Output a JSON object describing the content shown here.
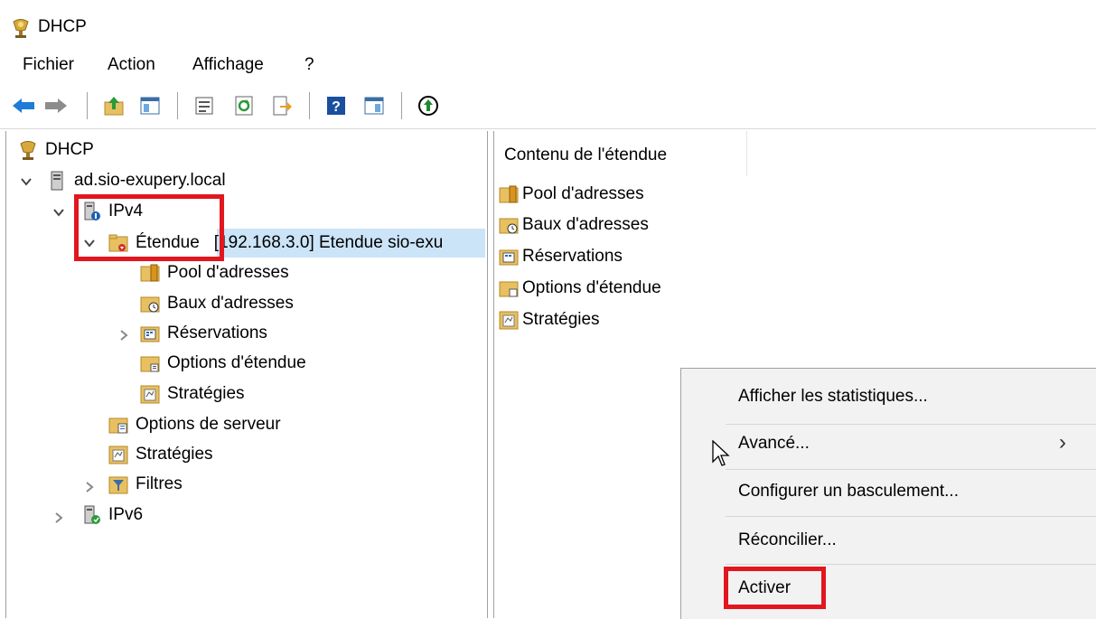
{
  "window": {
    "title": "DHCP"
  },
  "menu": [
    {
      "label": "Fichier"
    },
    {
      "label": "Action"
    },
    {
      "label": "Affichage"
    },
    {
      "label": "?"
    }
  ],
  "toolbar": {
    "icons": [
      "back-arrow-icon",
      "forward-arrow-icon",
      "up-folder-icon",
      "show-hide-tree-icon",
      "properties-icon",
      "refresh-icon",
      "export-list-icon",
      "help-icon",
      "action-pane-icon",
      "activate-icon"
    ],
    "colors": {
      "back": "#1e7bd6",
      "forward": "#8c8c8c",
      "help": "#1a4fa0",
      "activate_circle": "#000000",
      "activate_arrow": "#1c8a2f"
    }
  },
  "tree": {
    "root": "DHCP",
    "server": "ad.sio-exupery.local",
    "ipv4": "IPv4",
    "scope_label": "Étendue",
    "scope_rest": "[192.168.3.0] Etendue sio-exu",
    "scope_children": [
      "Pool d'adresses",
      "Baux d'adresses",
      "Réservations",
      "Options d'étendue",
      "Stratégies"
    ],
    "server_options": "Options de serveur",
    "policies": "Stratégies",
    "filters": "Filtres",
    "ipv6": "IPv6"
  },
  "content": {
    "column_header": "Contenu de l'étendue",
    "items": [
      "Pool d'adresses",
      "Baux d'adresses",
      "Réservations",
      "Options d'étendue",
      "Stratégies"
    ]
  },
  "context_menu": {
    "items": [
      {
        "label": "Afficher les statistiques..."
      },
      {
        "label": "Avancé...",
        "submenu": true
      },
      {
        "label": "Configurer un basculement..."
      },
      {
        "label": "Réconcilier..."
      },
      {
        "label": "Activer"
      }
    ],
    "submenu_glyph": "›"
  },
  "highlight_color": "#e2161e"
}
